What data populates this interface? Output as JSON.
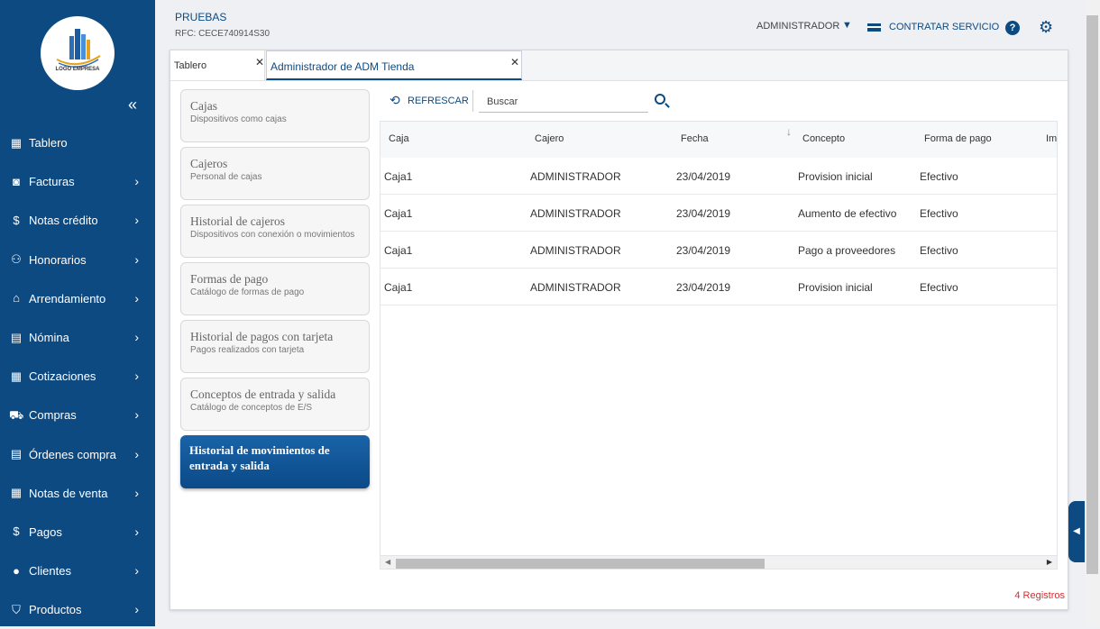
{
  "logo": {
    "text": "LOGO EMPRESA"
  },
  "sidebar": {
    "collapse_icon": "«",
    "items": [
      {
        "label": "Tablero",
        "icon": "dashboard-icon",
        "glyph": "▦",
        "has_arrow": false
      },
      {
        "label": "Facturas",
        "icon": "invoice-icon",
        "glyph": "◙",
        "has_arrow": true
      },
      {
        "label": "Notas crédito",
        "icon": "credit-note-icon",
        "glyph": "$",
        "has_arrow": true
      },
      {
        "label": "Honorarios",
        "icon": "fees-icon",
        "glyph": "⚇",
        "has_arrow": true
      },
      {
        "label": "Arrendamiento",
        "icon": "home-icon",
        "glyph": "⌂",
        "has_arrow": true
      },
      {
        "label": "Nómina",
        "icon": "payroll-icon",
        "glyph": "▤",
        "has_arrow": true
      },
      {
        "label": "Cotizaciones",
        "icon": "calculator-icon",
        "glyph": "▦",
        "has_arrow": true
      },
      {
        "label": "Compras",
        "icon": "cart-icon",
        "glyph": "⛟",
        "has_arrow": true
      },
      {
        "label": "Órdenes compra",
        "icon": "document-icon",
        "glyph": "▤",
        "has_arrow": true
      },
      {
        "label": "Notas de venta",
        "icon": "receipt-icon",
        "glyph": "▦",
        "has_arrow": true
      },
      {
        "label": "Pagos",
        "icon": "payments-icon",
        "glyph": "$",
        "has_arrow": true
      },
      {
        "label": "Clientes",
        "icon": "user-icon",
        "glyph": "●",
        "has_arrow": true
      },
      {
        "label": "Productos",
        "icon": "basket-icon",
        "glyph": "⛉",
        "has_arrow": true
      }
    ]
  },
  "header": {
    "company": "PRUEBAS",
    "rfc": "RFC: CECE740914S30",
    "user": "ADMINISTRADOR",
    "contract": "CONTRATAR SERVICIO",
    "help": "?",
    "gear": "⚙"
  },
  "tabs": [
    {
      "label": "Tablero",
      "close": "✕"
    },
    {
      "label": "Administrador de ADM Tienda",
      "close": "✕"
    }
  ],
  "menu": [
    {
      "title": "Cajas",
      "subtitle": "Dispositivos como cajas"
    },
    {
      "title": "Cajeros",
      "subtitle": "Personal de cajas"
    },
    {
      "title": "Historial de cajeros",
      "subtitle": "Dispositivos con conexión o movimientos"
    },
    {
      "title": "Formas de pago",
      "subtitle": "Catálogo de formas de pago"
    },
    {
      "title": "Historial de pagos con tarjeta",
      "subtitle": "Pagos realizados con tarjeta"
    },
    {
      "title": "Conceptos de entrada y salida",
      "subtitle": "Catálogo de conceptos de E/S"
    },
    {
      "title": "Historial de movimientos de entrada y salida",
      "subtitle": "",
      "active": true
    }
  ],
  "toolbar": {
    "refresh": "REFRESCAR",
    "search_placeholder": "Buscar"
  },
  "table": {
    "columns": [
      "Caja",
      "Cajero",
      "Fecha",
      "Concepto",
      "Forma de pago",
      "Im"
    ],
    "rows": [
      [
        "Caja1",
        "ADMINISTRADOR",
        "23/04/2019",
        "Provision inicial",
        "Efectivo"
      ],
      [
        "Caja1",
        "ADMINISTRADOR",
        "23/04/2019",
        "Aumento de efectivo",
        "Efectivo"
      ],
      [
        "Caja1",
        "ADMINISTRADOR",
        "23/04/2019",
        "Pago a proveedores",
        "Efectivo"
      ],
      [
        "Caja1",
        "ADMINISTRADOR",
        "23/04/2019",
        "Provision inicial",
        "Efectivo"
      ]
    ]
  },
  "footer": {
    "count": "4 Registros"
  },
  "colors": {
    "primary": "#0d4a82",
    "count": "#d32f2f"
  }
}
